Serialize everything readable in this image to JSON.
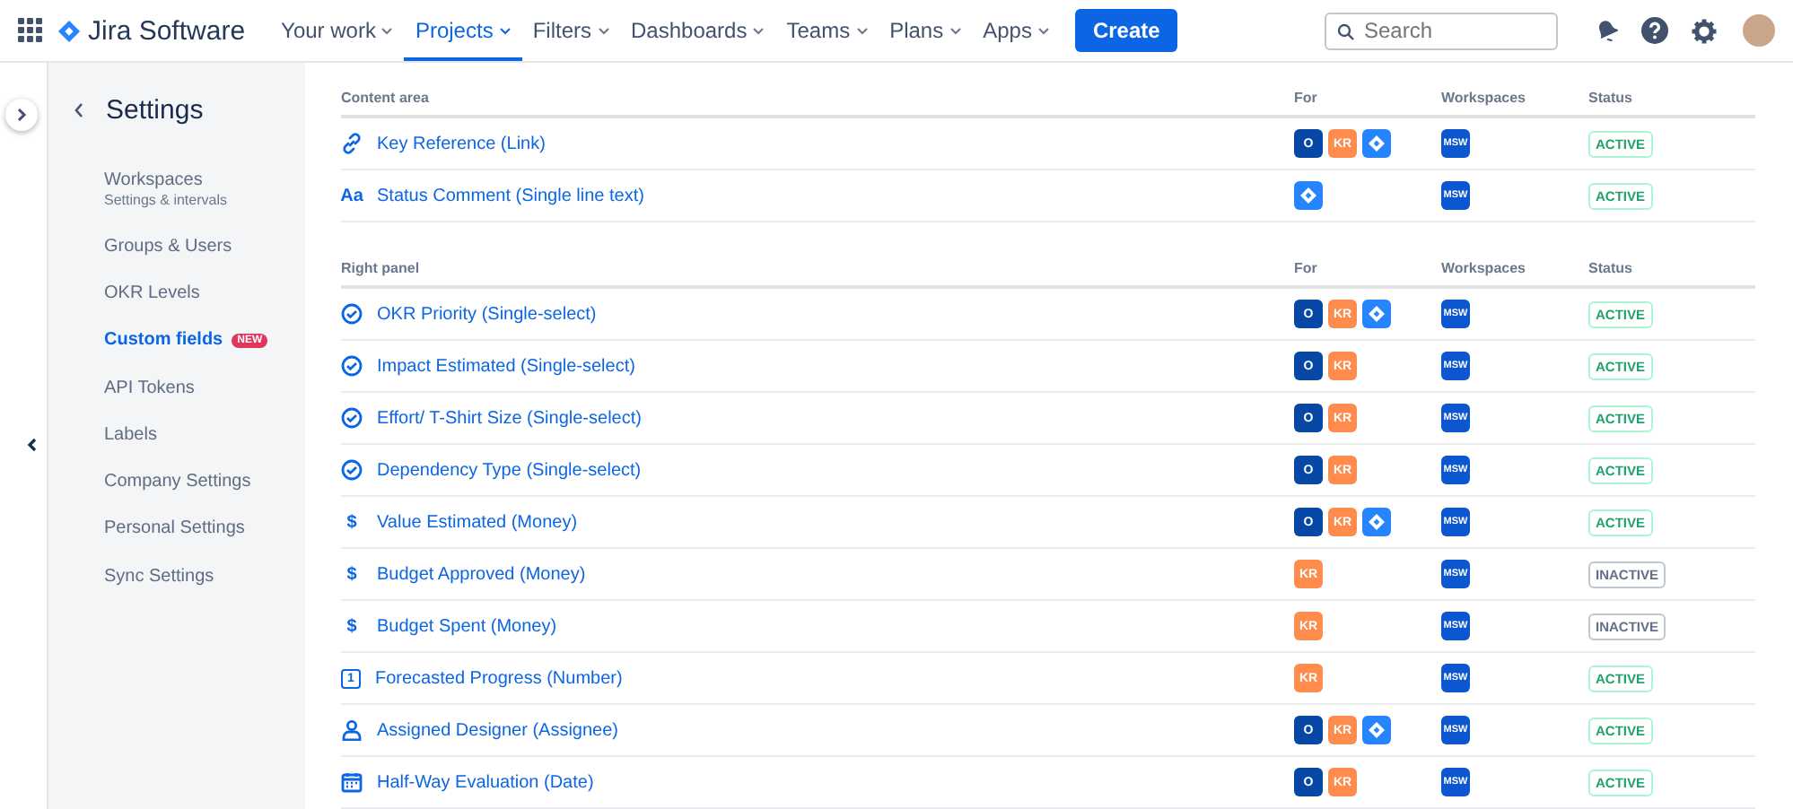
{
  "app": {
    "name": "Jira Software"
  },
  "nav": [
    {
      "label": "Your work",
      "selected": false
    },
    {
      "label": "Projects",
      "selected": true
    },
    {
      "label": "Filters",
      "selected": false
    },
    {
      "label": "Dashboards",
      "selected": false
    },
    {
      "label": "Teams",
      "selected": false
    },
    {
      "label": "Plans",
      "selected": false
    },
    {
      "label": "Apps",
      "selected": false
    }
  ],
  "create_button": "Create",
  "search": {
    "placeholder": "Search"
  },
  "sidebar": {
    "title": "Settings",
    "items": [
      {
        "label": "Workspaces",
        "subtitle": "Settings & intervals",
        "selected": false
      },
      {
        "label": "Groups & Users",
        "selected": false
      },
      {
        "label": "OKR Levels",
        "selected": false
      },
      {
        "label": "Custom fields",
        "badge": "NEW",
        "selected": true
      },
      {
        "label": "API Tokens",
        "selected": false
      },
      {
        "label": "Labels",
        "selected": false
      },
      {
        "label": "Company Settings",
        "selected": false
      },
      {
        "label": "Personal Settings",
        "selected": false
      },
      {
        "label": "Sync Settings",
        "selected": false
      }
    ]
  },
  "sections": [
    {
      "title": "Content area",
      "columns": [
        "For",
        "Workspaces",
        "Status"
      ],
      "rows": [
        {
          "kind": "link",
          "name": "Key Reference (Link)",
          "for": [
            {
              "kind": "objective",
              "label": "O"
            },
            {
              "kind": "key-result",
              "label": "KR"
            },
            {
              "kind": "jira"
            }
          ],
          "workspace": "MSW",
          "status": "ACTIVE",
          "active": true
        },
        {
          "kind": "text",
          "name": "Status Comment (Single line text)",
          "type_label": "Aa",
          "for": [
            {
              "kind": "jira"
            }
          ],
          "workspace": "MSW",
          "status": "ACTIVE",
          "active": true
        }
      ]
    },
    {
      "title": "Right panel",
      "columns": [
        "For",
        "Workspaces",
        "Status"
      ],
      "rows": [
        {
          "kind": "select",
          "name": "OKR Priority (Single-select)",
          "for": [
            {
              "kind": "objective",
              "label": "O"
            },
            {
              "kind": "key-result",
              "label": "KR"
            },
            {
              "kind": "jira"
            }
          ],
          "workspace": "MSW",
          "status": "ACTIVE",
          "active": true
        },
        {
          "kind": "select",
          "name": "Impact Estimated (Single-select)",
          "for": [
            {
              "kind": "objective",
              "label": "O"
            },
            {
              "kind": "key-result",
              "label": "KR"
            }
          ],
          "workspace": "MSW",
          "status": "ACTIVE",
          "active": true
        },
        {
          "kind": "select",
          "name": "Effort/ T-Shirt Size (Single-select)",
          "for": [
            {
              "kind": "objective",
              "label": "O"
            },
            {
              "kind": "key-result",
              "label": "KR"
            }
          ],
          "workspace": "MSW",
          "status": "ACTIVE",
          "active": true
        },
        {
          "kind": "select",
          "name": "Dependency Type (Single-select)",
          "for": [
            {
              "kind": "objective",
              "label": "O"
            },
            {
              "kind": "key-result",
              "label": "KR"
            }
          ],
          "workspace": "MSW",
          "status": "ACTIVE",
          "active": true
        },
        {
          "kind": "money",
          "name": "Value Estimated (Money)",
          "type_label": "$",
          "for": [
            {
              "kind": "objective",
              "label": "O"
            },
            {
              "kind": "key-result",
              "label": "KR"
            },
            {
              "kind": "jira"
            }
          ],
          "workspace": "MSW",
          "status": "ACTIVE",
          "active": true
        },
        {
          "kind": "money",
          "name": "Budget Approved (Money)",
          "type_label": "$",
          "for": [
            {
              "kind": "key-result",
              "label": "KR"
            }
          ],
          "workspace": "MSW",
          "status": "INACTIVE",
          "active": false
        },
        {
          "kind": "money",
          "name": "Budget Spent (Money)",
          "type_label": "$",
          "for": [
            {
              "kind": "key-result",
              "label": "KR"
            }
          ],
          "workspace": "MSW",
          "status": "INACTIVE",
          "active": false
        },
        {
          "kind": "number",
          "name": "Forecasted Progress (Number)",
          "type_label": "1",
          "for": [
            {
              "kind": "key-result",
              "label": "KR"
            }
          ],
          "workspace": "MSW",
          "status": "ACTIVE",
          "active": true
        },
        {
          "kind": "user",
          "name": "Assigned Designer (Assignee)",
          "for": [
            {
              "kind": "objective",
              "label": "O"
            },
            {
              "kind": "key-result",
              "label": "KR"
            },
            {
              "kind": "jira"
            }
          ],
          "workspace": "MSW",
          "status": "ACTIVE",
          "active": true
        },
        {
          "kind": "date",
          "name": "Half-Way Evaluation (Date)",
          "for": [
            {
              "kind": "objective",
              "label": "O"
            },
            {
              "kind": "key-result",
              "label": "KR"
            }
          ],
          "workspace": "MSW",
          "status": "ACTIVE",
          "active": true
        }
      ]
    }
  ]
}
